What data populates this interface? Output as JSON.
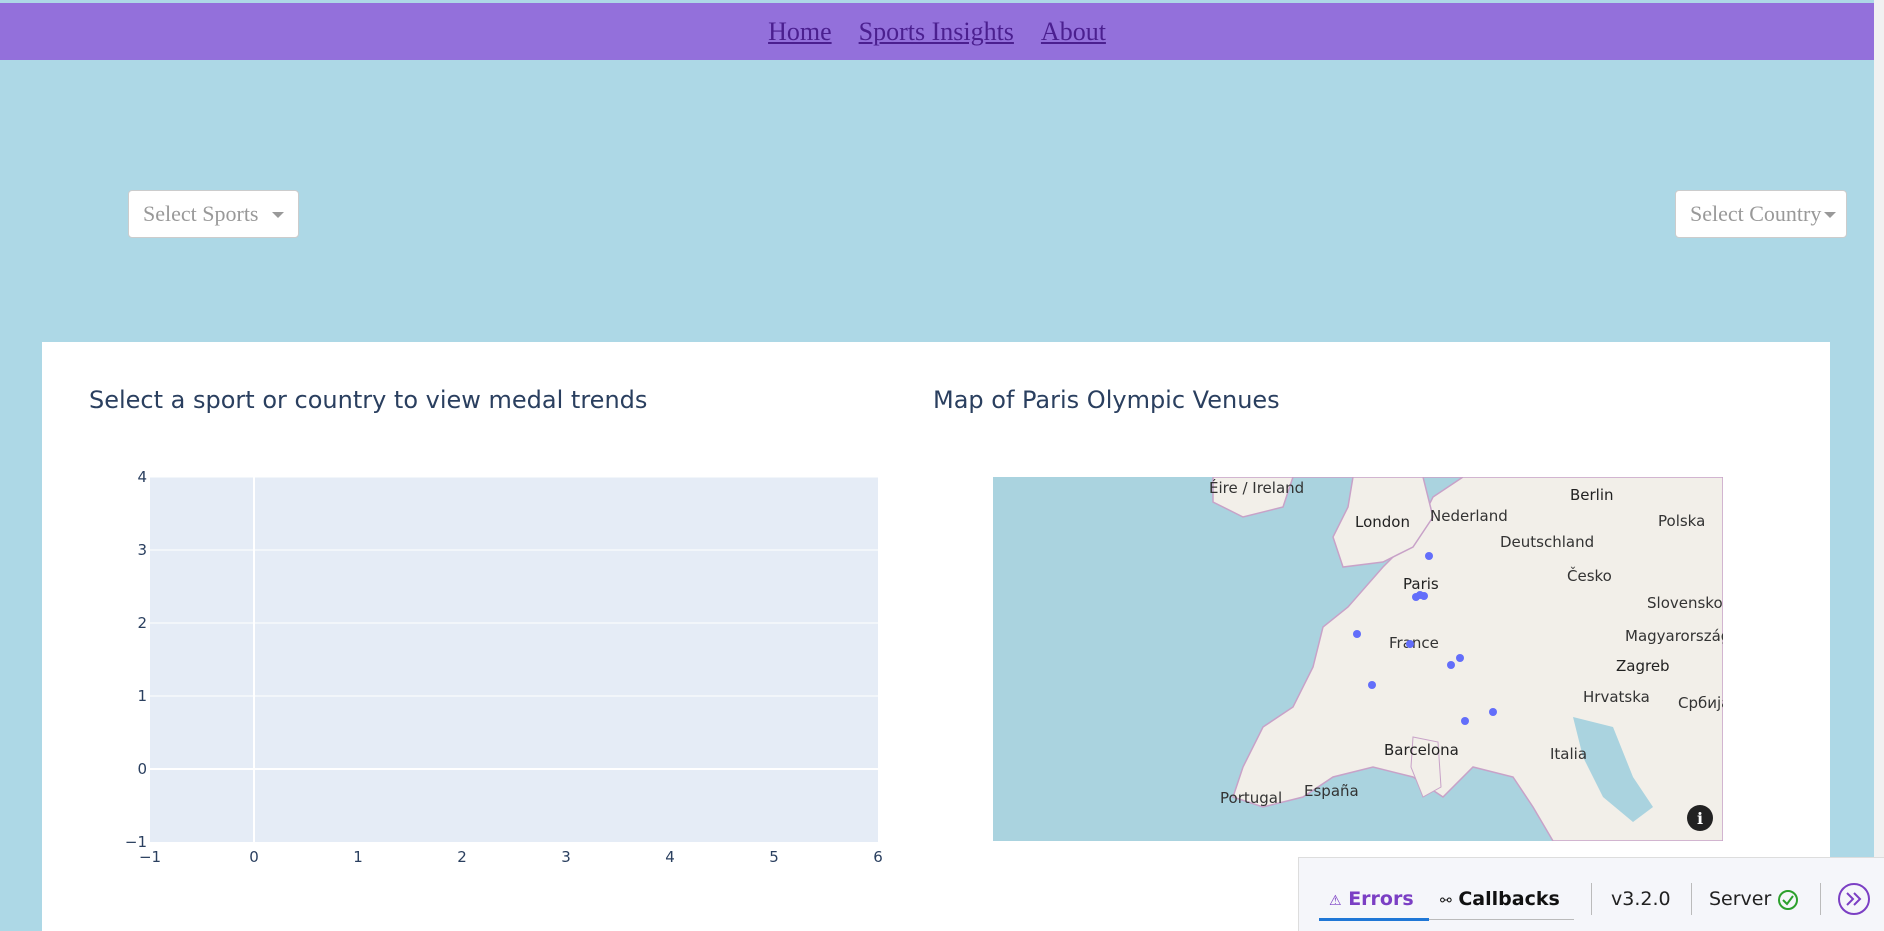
{
  "nav": {
    "links": [
      "Home",
      "Sports Insights",
      "About"
    ]
  },
  "filters": {
    "sports_placeholder": "Select Sports",
    "country_placeholder": "Select Country"
  },
  "trend_chart": {
    "title": "Select a sport or country to view medal trends"
  },
  "map": {
    "title": "Map of Paris Olympic Venues",
    "labels": [
      "Éire / Ireland",
      "London",
      "Nederland",
      "Berlin",
      "Polska",
      "Deutschland",
      "Česko",
      "Paris",
      "Slovensko",
      "France",
      "Magyarország",
      "Zagreb",
      "Hrvatska",
      "Србија",
      "Italia",
      "Barcelona",
      "Portugal",
      "España"
    ]
  },
  "chart_data": {
    "type": "scatter",
    "title": "Select a sport or country to view medal trends",
    "x": [],
    "y": [],
    "xlim": [
      -1,
      6
    ],
    "ylim": [
      -1,
      4
    ],
    "xticks": [
      "−1",
      "0",
      "1",
      "2",
      "3",
      "4",
      "5",
      "6"
    ],
    "yticks": [
      "−1",
      "0",
      "1",
      "2",
      "3",
      "4"
    ],
    "grid": true,
    "colors": {
      "plot_bg": "#e5ecf6",
      "grid": "#ffffff",
      "tick": "#2a3f5f"
    }
  },
  "dev_tools": {
    "errors_label": "Errors",
    "callbacks_label": "Callbacks",
    "version": "v3.2.0",
    "server_label": "Server"
  },
  "colors": {
    "navbar": "#9370db",
    "background": "#add8e6",
    "accent": "#7b3fc4"
  }
}
